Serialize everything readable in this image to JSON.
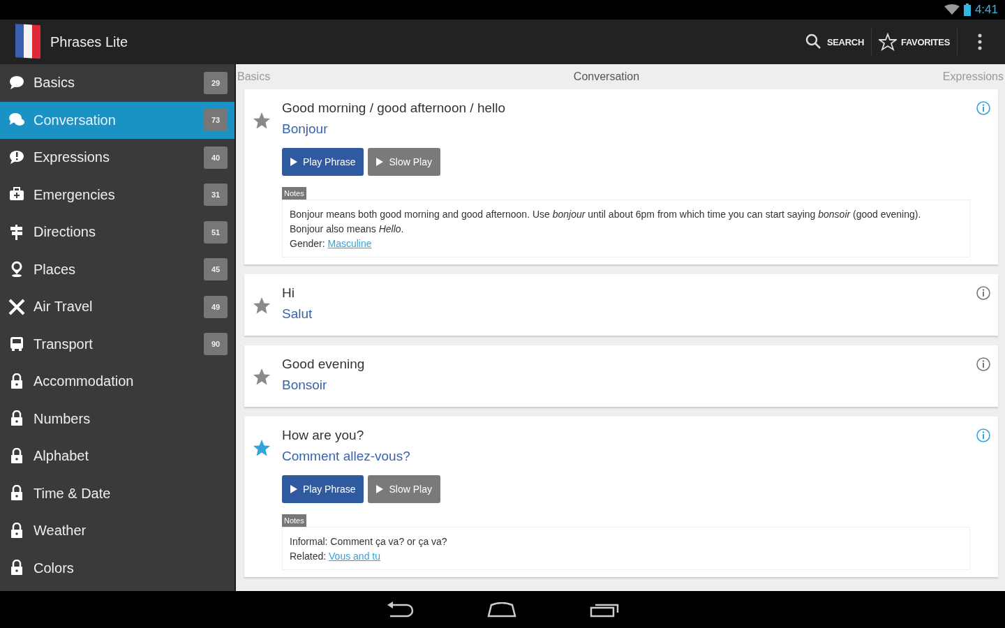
{
  "status_bar": {
    "time": "4:41"
  },
  "action_bar": {
    "title": "Phrases Lite",
    "actions": [
      {
        "label": "SEARCH",
        "kind": "search"
      },
      {
        "label": "FAVORITES",
        "kind": "favorites"
      }
    ]
  },
  "sidebar": {
    "items": [
      {
        "label": "Basics",
        "count": "29",
        "locked": false,
        "selected": false
      },
      {
        "label": "Conversation",
        "count": "73",
        "locked": false,
        "selected": true
      },
      {
        "label": "Expressions",
        "count": "40",
        "locked": false,
        "selected": false
      },
      {
        "label": "Emergencies",
        "count": "31",
        "locked": false,
        "selected": false
      },
      {
        "label": "Directions",
        "count": "51",
        "locked": false,
        "selected": false
      },
      {
        "label": "Places",
        "count": "45",
        "locked": false,
        "selected": false
      },
      {
        "label": "Air Travel",
        "count": "49",
        "locked": false,
        "selected": false
      },
      {
        "label": "Transport",
        "count": "90",
        "locked": false,
        "selected": false
      },
      {
        "label": "Accommodation",
        "locked": true,
        "selected": false
      },
      {
        "label": "Numbers",
        "locked": true,
        "selected": false
      },
      {
        "label": "Alphabet",
        "locked": true,
        "selected": false
      },
      {
        "label": "Time & Date",
        "locked": true,
        "selected": false
      },
      {
        "label": "Weather",
        "locked": true,
        "selected": false
      },
      {
        "label": "Colors",
        "locked": true,
        "selected": false
      }
    ]
  },
  "tabs": [
    {
      "label": "Basics",
      "selected": false
    },
    {
      "label": "Conversation",
      "selected": true
    },
    {
      "label": "Expressions",
      "selected": false
    }
  ],
  "phrases": [
    {
      "english": "Good morning / good afternoon / hello",
      "french": "Bonjour",
      "favorite": false,
      "expanded": true,
      "buttons": [
        "Play Phrase",
        "Slow Play"
      ],
      "notes_label": "Notes",
      "notes": [
        {
          "text": "Bonjour means both good morning and good afternoon. Use *bonjour* until about 6pm from which time you can start saying *bonsoir* (good evening)."
        },
        {
          "text": "Bonjour also means *Hello*."
        },
        {
          "text": "Gender:",
          "link": "Masculine"
        }
      ]
    },
    {
      "english": "Hi",
      "french": "Salut",
      "favorite": false,
      "expanded": false
    },
    {
      "english": "Good evening",
      "french": "Bonsoir",
      "favorite": false,
      "expanded": false
    },
    {
      "english": "How are you?",
      "french": "Comment allez-vous?",
      "favorite": true,
      "expanded": true,
      "buttons": [
        "Play Phrase",
        "Slow Play"
      ],
      "notes_label": "Notes",
      "notes": [
        {
          "text": "Informal: Comment ça va? or ça va?"
        },
        {
          "text": "Related:",
          "link": "Vous and tu"
        }
      ]
    }
  ]
}
